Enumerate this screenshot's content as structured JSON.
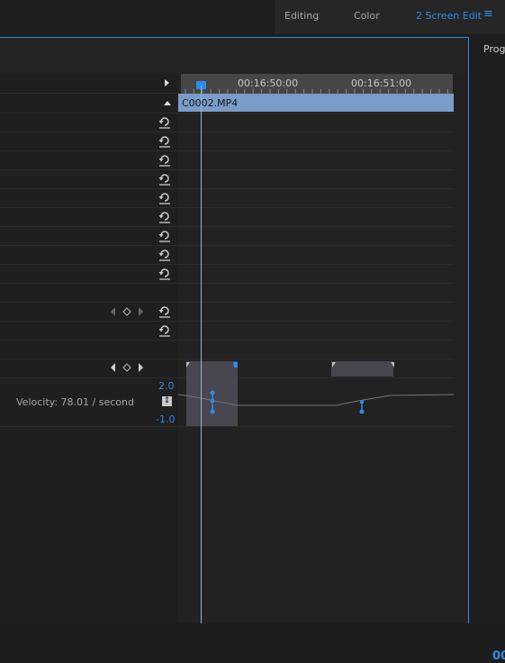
{
  "workspaces": {
    "items": [
      {
        "label": "Editing"
      },
      {
        "label": "Color"
      },
      {
        "label": "2 Screen Edit"
      }
    ],
    "active": "2 Screen Edit",
    "menu_icon": "hamburger-icon"
  },
  "program_panel": {
    "title": "Progr"
  },
  "timeline": {
    "timecodes": [
      "00:16:50:00",
      "00:16:51:00"
    ],
    "clip_name": "C0002.MP4"
  },
  "velocity": {
    "label": "Velocity: 78.01 / second",
    "max": "2.0",
    "min": "-1.0"
  },
  "colors": {
    "accent": "#2d8ceb",
    "clip": "#7a9cc9"
  }
}
